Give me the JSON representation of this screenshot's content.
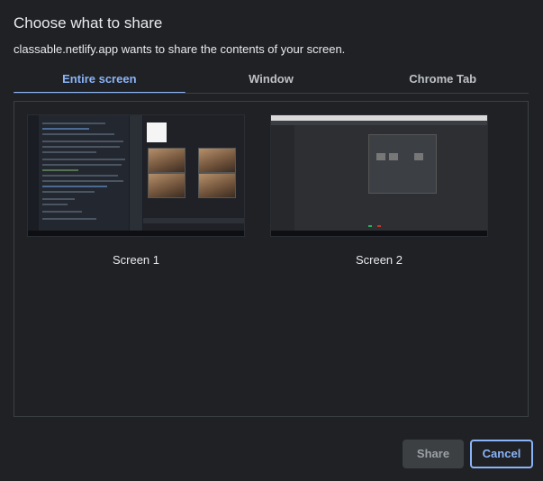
{
  "dialog": {
    "title": "Choose what to share",
    "subtitle": "classable.netlify.app wants to share the contents of your screen."
  },
  "tabs": [
    {
      "label": "Entire screen",
      "active": true
    },
    {
      "label": "Window",
      "active": false
    },
    {
      "label": "Chrome Tab",
      "active": false
    }
  ],
  "screens": [
    {
      "label": "Screen 1"
    },
    {
      "label": "Screen 2"
    }
  ],
  "buttons": {
    "share_label": "Share",
    "cancel_label": "Cancel"
  },
  "colors": {
    "accent": "#8ab4f8",
    "background": "#202124"
  }
}
